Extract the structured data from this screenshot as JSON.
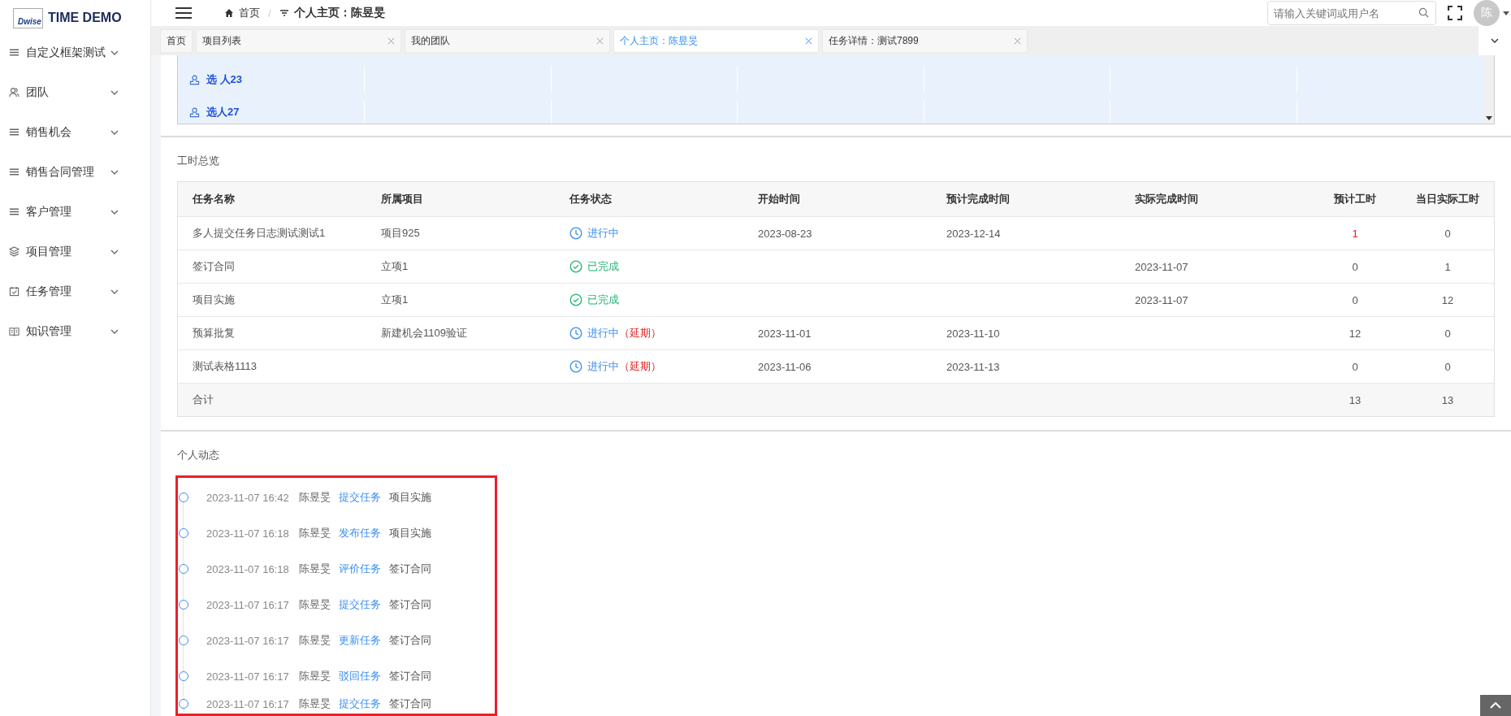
{
  "logo": {
    "badge": "Dwise",
    "title": "TIME DEMO"
  },
  "sidebar": {
    "items": [
      {
        "label": "自定义框架测试",
        "kind": "lines",
        "expanded": false
      },
      {
        "label": "团队",
        "kind": "people",
        "expanded": false
      },
      {
        "label": "销售机会",
        "kind": "lines",
        "expanded": false
      },
      {
        "label": "销售合同管理",
        "kind": "lines",
        "expanded": false
      },
      {
        "label": "客户管理",
        "kind": "lines",
        "expanded": false
      },
      {
        "label": "项目管理",
        "kind": "layers",
        "expanded": false
      },
      {
        "label": "任务管理",
        "kind": "calendar",
        "expanded": false
      },
      {
        "label": "知识管理",
        "kind": "book",
        "expanded": false
      }
    ]
  },
  "breadcrumb": {
    "separator": "/",
    "items": [
      {
        "label": "首页",
        "kind": "home"
      },
      {
        "label": "个人主页：陈昱旻",
        "kind": "filter"
      }
    ]
  },
  "search": {
    "placeholder": "请输入关键词或用户名"
  },
  "avatar": {
    "initial": "陈"
  },
  "tabs": [
    {
      "label": "首页",
      "closable": false,
      "selected": false
    },
    {
      "label": "项目列表",
      "closable": true,
      "selected": false
    },
    {
      "label": "我的团队",
      "closable": true,
      "selected": false
    },
    {
      "label": "个人主页：陈昱旻",
      "closable": true,
      "selected": true
    },
    {
      "label": "任务详情：测试7899",
      "closable": true,
      "selected": false
    }
  ],
  "member_table": {
    "rows": [
      {
        "name": "选 人23"
      },
      {
        "name": "选人27"
      }
    ]
  },
  "worktime": {
    "title": "工时总览",
    "columns": [
      "任务名称",
      "所属项目",
      "任务状态",
      "开始时间",
      "预计完成时间",
      "实际完成时间",
      "预计工时",
      "当日实际工时"
    ],
    "rows": [
      {
        "task": "多人提交任务日志测试测试1",
        "project": "项目925",
        "status": {
          "kind": "in_progress",
          "label": "进行中"
        },
        "start": "2023-08-23",
        "planned_end": "2023-12-14",
        "planned_hours": "1",
        "planned_over": true,
        "actual_hours": "0"
      },
      {
        "task": "签订合同",
        "project": "立项1",
        "status": {
          "kind": "done",
          "label": "已完成"
        },
        "actual_end": "2023-11-07",
        "planned_hours": "0",
        "planned_over": false,
        "actual_hours": "1"
      },
      {
        "task": "项目实施",
        "project": "立项1",
        "status": {
          "kind": "done",
          "label": "已完成"
        },
        "actual_end": "2023-11-07",
        "planned_hours": "0",
        "planned_over": false,
        "actual_hours": "12"
      },
      {
        "task": "预算批复",
        "project": "新建机会1109验证",
        "status": {
          "kind": "in_progress",
          "label": "进行中",
          "note": "（延期）"
        },
        "start": "2023-11-01",
        "planned_end": "2023-11-10",
        "planned_hours": "12",
        "planned_over": false,
        "actual_hours": "0"
      },
      {
        "task": "测试表格1113",
        "status": {
          "kind": "in_progress",
          "label": "进行中",
          "note": "（延期）"
        },
        "start": "2023-11-06",
        "planned_end": "2023-11-13",
        "planned_hours": "0",
        "planned_over": false,
        "actual_hours": "0"
      }
    ],
    "total": {
      "label": "合计",
      "planned_hours": "13",
      "actual_hours": "13"
    }
  },
  "activity": {
    "title": "个人动态",
    "highlighted": true,
    "items": [
      {
        "time": "2023-11-07 16:42",
        "user": "陈昱旻",
        "action": "提交任务",
        "target": "项目实施"
      },
      {
        "time": "2023-11-07 16:18",
        "user": "陈昱旻",
        "action": "发布任务",
        "target": "项目实施"
      },
      {
        "time": "2023-11-07 16:18",
        "user": "陈昱旻",
        "action": "评价任务",
        "target": "签订合同"
      },
      {
        "time": "2023-11-07 16:17",
        "user": "陈昱旻",
        "action": "提交任务",
        "target": "签订合同"
      },
      {
        "time": "2023-11-07 16:17",
        "user": "陈昱旻",
        "action": "更新任务",
        "target": "签订合同"
      },
      {
        "time": "2023-11-07 16:17",
        "user": "陈昱旻",
        "action": "驳回任务",
        "target": "签订合同"
      },
      {
        "time": "2023-11-07 16:17",
        "user": "陈昱旻",
        "action": "提交任务",
        "target": "签订合同"
      }
    ]
  }
}
